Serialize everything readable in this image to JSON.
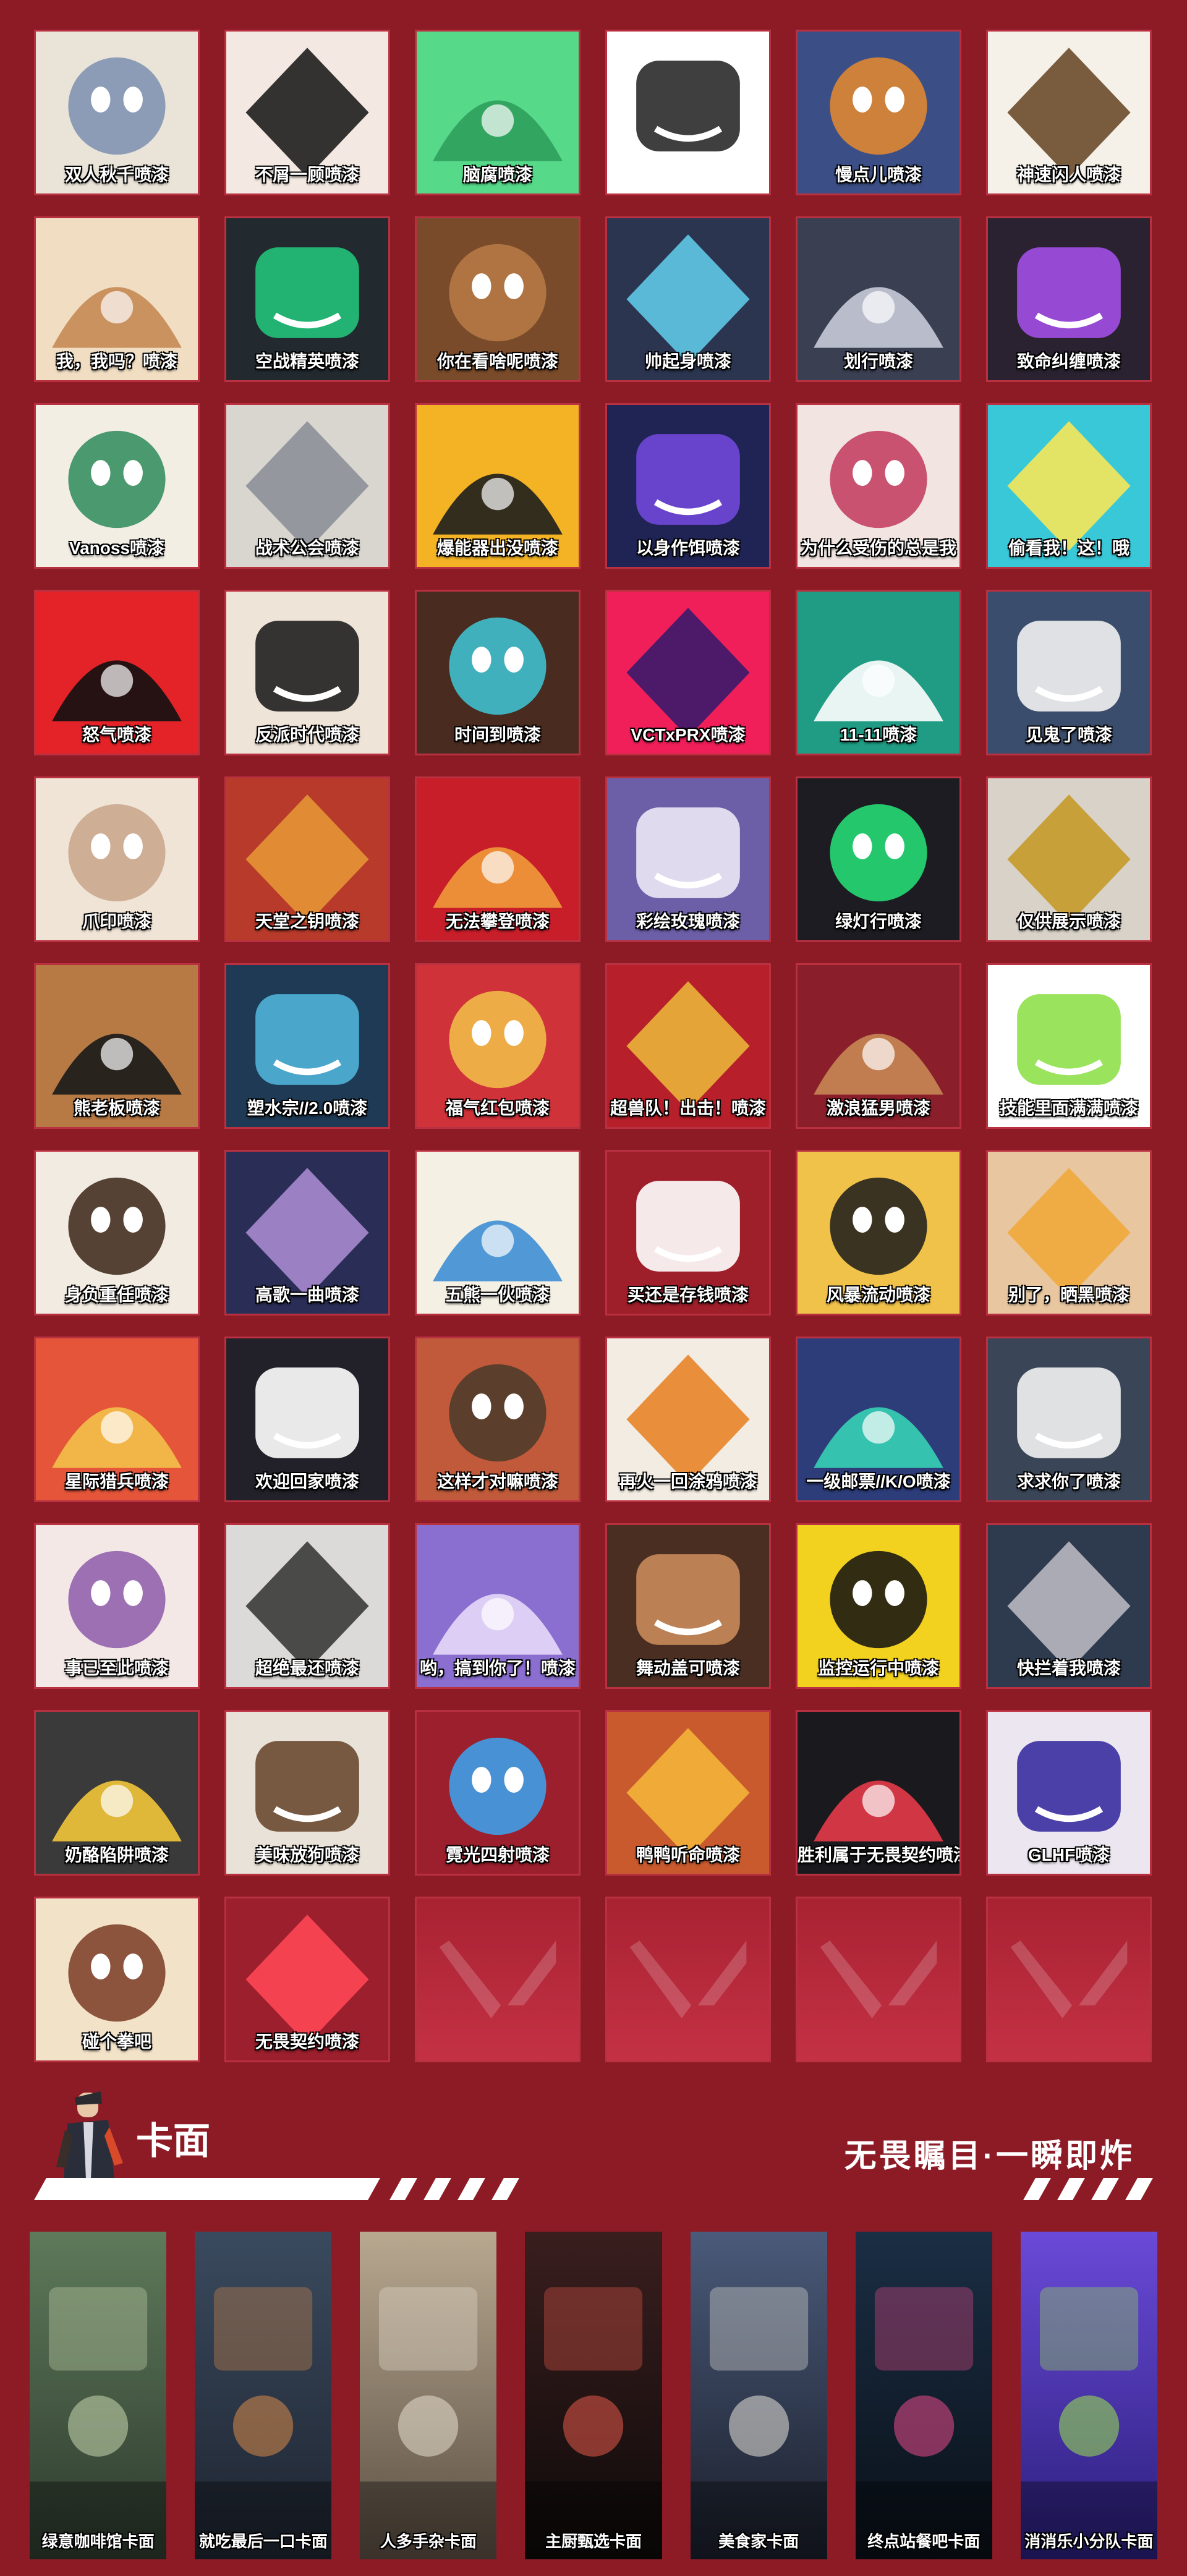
{
  "sprays": [
    {
      "label": "双人秋千喷漆",
      "bg": "#e9e3d8",
      "accent": "#7b8fb0",
      "icon": "duo-characters-icon"
    },
    {
      "label": "不屑一顾喷漆",
      "bg": "#f3e9e2",
      "accent": "#1e1e1e",
      "icon": "dismissive-face-icon"
    },
    {
      "label": "脑腐喷漆",
      "bg": "#57d98a",
      "accent": "#2f9e5c",
      "icon": "green-brain-icon"
    },
    {
      "label": "",
      "bg": "#ffffff",
      "accent": "#2a2a2a",
      "icon": "cat-tongue-icon"
    },
    {
      "label": "慢点儿喷漆",
      "bg": "#3b4f86",
      "accent": "#e88a2d",
      "icon": "robot-head-icon"
    },
    {
      "label": "神速闪人喷漆",
      "bg": "#f5f1e8",
      "accent": "#6b4a2b",
      "icon": "surprised-face-icon"
    },
    {
      "label": "我，我吗？喷漆",
      "bg": "#f0ddc2",
      "accent": "#c58a54",
      "icon": "question-face-icon"
    },
    {
      "label": "空战精英喷漆",
      "bg": "#222a30",
      "accent": "#22c27a",
      "icon": "green-gem-icon"
    },
    {
      "label": "你在看啥呢喷漆",
      "bg": "#7a4b2a",
      "accent": "#b87b46",
      "icon": "bear-face-icon"
    },
    {
      "label": "帅起身喷漆",
      "bg": "#2b3550",
      "accent": "#5ec8e6",
      "icon": "rifle-icon"
    },
    {
      "label": "划行喷漆",
      "bg": "#3a3f52",
      "accent": "#c8cbd8",
      "icon": "masked-face-icon"
    },
    {
      "label": "致命纠缠喷漆",
      "bg": "#2a2230",
      "accent": "#a24ee6",
      "icon": "purple-heart-icon"
    },
    {
      "label": "Vanoss喷漆",
      "bg": "#f3eee4",
      "accent": "#2d8a59",
      "icon": "laughing-face-icon"
    },
    {
      "label": "战术公会喷漆",
      "bg": "#d9d6cf",
      "accent": "#8d9099",
      "icon": "knight-helmet-icon"
    },
    {
      "label": "爆能器出没喷漆",
      "bg": "#f3b324",
      "accent": "#1e1e1e",
      "icon": "warning-sign-icon"
    },
    {
      "label": "以身作饵喷漆",
      "bg": "#1f2454",
      "accent": "#6f48d8",
      "icon": "hooded-figure-icon"
    },
    {
      "label": "为什么受伤的总是我",
      "bg": "#f2e4e0",
      "accent": "#c2385c",
      "icon": "screaming-face-icon"
    },
    {
      "label": "偷看我！这！哦",
      "bg": "#39c8d8",
      "accent": "#f6e65a",
      "icon": "peeking-face-icon"
    },
    {
      "label": "怒气喷漆",
      "bg": "#e42328",
      "accent": "#111111",
      "icon": "anger-mark-icon"
    },
    {
      "label": "反派时代喷漆",
      "bg": "#efe4d8",
      "accent": "#1f1f1f",
      "icon": "villain-laugh-icon"
    },
    {
      "label": "时间到喷漆",
      "bg": "#4a2b20",
      "accent": "#3ec9d8",
      "icon": "glare-eyes-icon"
    },
    {
      "label": "VCTxPRX喷漆",
      "bg": "#f01f5a",
      "accent": "#3a1a6a",
      "icon": "vct-prx-logo-icon"
    },
    {
      "label": "11-11喷漆",
      "bg": "#1f9c83",
      "accent": "#ffffff",
      "icon": "number-eleven-icon"
    },
    {
      "label": "见鬼了喷漆",
      "bg": "#3b4d6c",
      "accent": "#f2f2f2",
      "icon": "penguin-eyes-icon"
    },
    {
      "label": "爪印喷漆",
      "bg": "#f0e4d6",
      "accent": "#c8a58a",
      "icon": "open-hand-icon"
    },
    {
      "label": "天堂之钥喷漆",
      "bg": "#b83a2a",
      "accent": "#e69536",
      "icon": "red-scythe-icon"
    },
    {
      "label": "无法攀登喷漆",
      "bg": "#c81e2a",
      "accent": "#f09a3a",
      "icon": "red-car-icon"
    },
    {
      "label": "彩绘玫瑰喷漆",
      "bg": "#6c5fa8",
      "accent": "#ece8f4",
      "icon": "white-rose-icon"
    },
    {
      "label": "绿灯行喷漆",
      "bg": "#1c1c22",
      "accent": "#27e57a",
      "icon": "green-light-icon"
    },
    {
      "label": "仅供展示喷漆",
      "bg": "#d8d2c8",
      "accent": "#c79a2a",
      "icon": "gold-plate-icon"
    },
    {
      "label": "熊老板喷漆",
      "bg": "#b87a44",
      "accent": "#1a1a1a",
      "icon": "bear-sunglasses-icon"
    },
    {
      "label": "塑水宗//2.0喷漆",
      "bg": "#1e3a54",
      "accent": "#4fb3d8",
      "icon": "ninja-face-icon"
    },
    {
      "label": "福气红包喷漆",
      "bg": "#d0323a",
      "accent": "#f3c24a",
      "icon": "gold-horse-icon"
    },
    {
      "label": "超兽队！出击！喷漆",
      "bg": "#b7202a",
      "accent": "#e9b23a",
      "icon": "ranger-helmet-icon"
    },
    {
      "label": "激浪猛男喷漆",
      "bg": "#8a1e2a",
      "accent": "#c78654",
      "icon": "flex-arm-icon"
    },
    {
      "label": "技能里面满满喷漆",
      "bg": "#ffffff",
      "accent": "#8fe04a",
      "icon": "green-slime-icon"
    },
    {
      "label": "身负重任喷漆",
      "bg": "#f2ebe2",
      "accent": "#3a2416",
      "icon": "braids-face-icon"
    },
    {
      "label": "高歌一曲喷漆",
      "bg": "#2a2e56",
      "accent": "#a88ad0",
      "icon": "singing-face-icon"
    },
    {
      "label": "五熊一伙喷漆",
      "bg": "#f5f0e4",
      "accent": "#3f8fd4",
      "icon": "bear-penguin-icon"
    },
    {
      "label": "买还是存钱喷漆",
      "bg": "#9e1e2a",
      "accent": "#ffffff",
      "icon": "x-circle-icon"
    },
    {
      "label": "风暴流动喷漆",
      "bg": "#f0c24a",
      "accent": "#1a1a1a",
      "icon": "spiky-hair-icon"
    },
    {
      "label": "别了，晒黑喷漆",
      "bg": "#e7c6a0",
      "accent": "#f1a83a",
      "icon": "shades-grin-icon"
    },
    {
      "label": "星际猎兵喷漆",
      "bg": "#e5553a",
      "accent": "#f3c04a",
      "icon": "red-diamond-icon"
    },
    {
      "label": "欢迎回家喷漆",
      "bg": "#222028",
      "accent": "#ffffff",
      "icon": "laughing-cat-icon"
    },
    {
      "label": "这样才对嘛喷漆",
      "bg": "#c05a3a",
      "accent": "#4a3a2a",
      "icon": "bearded-face-icon"
    },
    {
      "label": "再火一回涂鸦喷漆",
      "bg": "#f2ece2",
      "accent": "#e8852a",
      "icon": "grumpy-face-icon"
    },
    {
      "label": "一级邮票//K/O喷漆",
      "bg": "#2c3d7a",
      "accent": "#36d0b4",
      "icon": "ko-stamp-icon"
    },
    {
      "label": "求求你了喷漆",
      "bg": "#3a4658",
      "accent": "#f2f2f2",
      "icon": "penguin-plead-icon"
    },
    {
      "label": "事已至此喷漆",
      "bg": "#f3e8e6",
      "accent": "#8c5aa8",
      "icon": "tired-face-icon"
    },
    {
      "label": "超绝最还喷漆",
      "bg": "#dcdad8",
      "accent": "#3a3a3a",
      "icon": "silver-hair-icon"
    },
    {
      "label": "哟，搞到你了！喷漆",
      "bg": "#8a6ed0",
      "accent": "#e6d8f8",
      "icon": "purple-shades-icon"
    },
    {
      "label": "舞动盖可喷漆",
      "bg": "#4a2e22",
      "accent": "#c88a5a",
      "icon": "smug-face-icon"
    },
    {
      "label": "监控运行中喷漆",
      "bg": "#f2d21e",
      "accent": "#111111",
      "icon": "yellow-bot-icon"
    },
    {
      "label": "快拦着我喷漆",
      "bg": "#2e3a4e",
      "accent": "#b8b8c0",
      "icon": "sloth-face-icon"
    },
    {
      "label": "奶酪陷阱喷漆",
      "bg": "#3a3a3a",
      "accent": "#f3c63a",
      "icon": "cheese-trap-icon"
    },
    {
      "label": "美味放狗喷漆",
      "bg": "#e9e2d8",
      "accent": "#6a4a32",
      "icon": "pixel-dog-icon"
    },
    {
      "label": "霓光四射喷漆",
      "bg": "#9b1f2c",
      "accent": "#3aa6f2",
      "icon": "neon-stars-icon"
    },
    {
      "label": "鸭鸭听命喷漆",
      "bg": "#c85a2e",
      "accent": "#f3b33a",
      "icon": "duck-face-icon"
    },
    {
      "label": "胜利属于无畏契约喷漆",
      "bg": "#1a1a1e",
      "accent": "#e63a48",
      "icon": "valorant-v-icon"
    },
    {
      "label": "GLHF喷漆",
      "bg": "#ebe6f0",
      "accent": "#3a2ea0",
      "icon": "glhf-graffiti-icon"
    },
    {
      "label": "碰个拳吧",
      "bg": "#f2e2c8",
      "accent": "#7a3a24",
      "icon": "fist-bump-icon"
    },
    {
      "label": "无畏契约喷漆",
      "bg": "#9b1f2c",
      "accent": "#ff4655",
      "icon": "valorant-logo-icon"
    }
  ],
  "empty_count": 4,
  "section": {
    "title": "卡面",
    "slogan": "无畏瞩目·一瞬即炸"
  },
  "cards": [
    {
      "label": "绿意咖啡馆卡面",
      "c1": "#5e7a5a",
      "c2": "#2e3a2e",
      "accent": "#c9d8b0",
      "icon": "cafe-scene-icon"
    },
    {
      "label": "就吃最后一口卡面",
      "c1": "#3a4a5e",
      "c2": "#1e2430",
      "accent": "#d88a4a",
      "icon": "market-scene-icon"
    },
    {
      "label": "人多手杂卡面",
      "c1": "#b8a890",
      "c2": "#5a4e42",
      "accent": "#e8e0d0",
      "icon": "kitchen-scene-icon"
    },
    {
      "label": "主厨甄选卡面",
      "c1": "#3a1e1e",
      "c2": "#0e0a0a",
      "accent": "#e65a4a",
      "icon": "sushi-scene-icon"
    },
    {
      "label": "美食家卡面",
      "c1": "#4a5a7a",
      "c2": "#1a1e2a",
      "accent": "#e8e4da",
      "icon": "dining-hall-icon"
    },
    {
      "label": "终点站餐吧卡面",
      "c1": "#1a2e44",
      "c2": "#0a1018",
      "accent": "#e84a8a",
      "icon": "neon-bar-icon"
    },
    {
      "label": "消消乐小分队卡面",
      "c1": "#6a4ad8",
      "c2": "#2a1e7a",
      "accent": "#9ae84a",
      "icon": "puzzle-game-icon"
    }
  ]
}
